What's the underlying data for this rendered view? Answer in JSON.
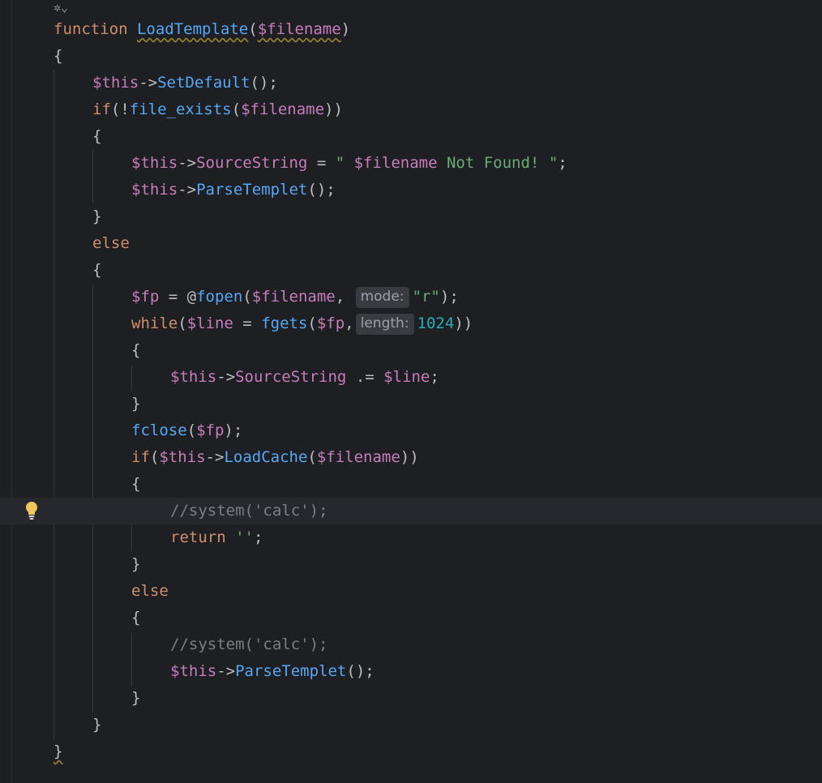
{
  "editor": {
    "top_icon": "✲⌄",
    "lines": [
      {
        "id": "l1",
        "tokens": [
          [
            "kw",
            "function"
          ],
          [
            "punc",
            " "
          ],
          [
            "fn-decl",
            "LoadTemplate"
          ],
          [
            "punc",
            "("
          ],
          [
            "param",
            "$filename"
          ],
          [
            "punc",
            ")"
          ]
        ]
      },
      {
        "id": "l2",
        "tokens": [
          [
            "punc",
            "{"
          ]
        ]
      },
      {
        "id": "l3",
        "tokens": [
          [
            "var",
            "$this"
          ],
          [
            "punc",
            "->"
          ],
          [
            "call",
            "SetDefault"
          ],
          [
            "punc",
            "();"
          ]
        ]
      },
      {
        "id": "l4",
        "tokens": [
          [
            "kw",
            "if"
          ],
          [
            "punc",
            "(!"
          ],
          [
            "call",
            "file_exists"
          ],
          [
            "punc",
            "("
          ],
          [
            "var",
            "$filename"
          ],
          [
            "punc",
            "))"
          ]
        ]
      },
      {
        "id": "l5",
        "tokens": [
          [
            "punc",
            "{"
          ]
        ]
      },
      {
        "id": "l6",
        "tokens": [
          [
            "var",
            "$this"
          ],
          [
            "punc",
            "->"
          ],
          [
            "prop",
            "SourceString"
          ],
          [
            "punc",
            " = "
          ],
          [
            "strq",
            "\" "
          ],
          [
            "var",
            "$filename"
          ],
          [
            "str",
            " Not Found! "
          ],
          [
            "strq",
            "\""
          ],
          [
            "punc",
            ";"
          ]
        ]
      },
      {
        "id": "l7",
        "tokens": [
          [
            "var",
            "$this"
          ],
          [
            "punc",
            "->"
          ],
          [
            "call",
            "ParseTemplet"
          ],
          [
            "punc",
            "();"
          ]
        ]
      },
      {
        "id": "l8",
        "tokens": [
          [
            "punc",
            "}"
          ]
        ]
      },
      {
        "id": "l9",
        "tokens": [
          [
            "kw",
            "else"
          ]
        ]
      },
      {
        "id": "l10",
        "tokens": [
          [
            "punc",
            "{"
          ]
        ]
      },
      {
        "id": "l11",
        "tokens": [
          [
            "var",
            "$fp"
          ],
          [
            "punc",
            " = @"
          ],
          [
            "call",
            "fopen"
          ],
          [
            "punc",
            "("
          ],
          [
            "var",
            "$filename"
          ],
          [
            "punc",
            ", "
          ],
          [
            "hint",
            "mode:"
          ],
          [
            "str",
            "\"r\""
          ],
          [
            "punc",
            ");"
          ]
        ]
      },
      {
        "id": "l12",
        "tokens": [
          [
            "kw",
            "while"
          ],
          [
            "punc",
            "("
          ],
          [
            "var",
            "$line"
          ],
          [
            "punc",
            " = "
          ],
          [
            "call",
            "fgets"
          ],
          [
            "punc",
            "("
          ],
          [
            "var",
            "$fp"
          ],
          [
            "punc",
            ","
          ],
          [
            "hint",
            "length:"
          ],
          [
            "num",
            "1024"
          ],
          [
            "punc",
            "))"
          ]
        ]
      },
      {
        "id": "l13",
        "tokens": [
          [
            "punc",
            "{"
          ]
        ]
      },
      {
        "id": "l14",
        "tokens": [
          [
            "var",
            "$this"
          ],
          [
            "punc",
            "->"
          ],
          [
            "prop",
            "SourceString"
          ],
          [
            "punc",
            " .= "
          ],
          [
            "var",
            "$line"
          ],
          [
            "punc",
            ";"
          ]
        ]
      },
      {
        "id": "l15",
        "tokens": [
          [
            "punc",
            "}"
          ]
        ]
      },
      {
        "id": "l16",
        "tokens": [
          [
            "call",
            "fclose"
          ],
          [
            "punc",
            "("
          ],
          [
            "var",
            "$fp"
          ],
          [
            "punc",
            ");"
          ]
        ]
      },
      {
        "id": "l17",
        "tokens": [
          [
            "kw",
            "if"
          ],
          [
            "punc",
            "("
          ],
          [
            "var",
            "$this"
          ],
          [
            "punc",
            "->"
          ],
          [
            "call",
            "LoadCache"
          ],
          [
            "punc",
            "("
          ],
          [
            "var",
            "$filename"
          ],
          [
            "punc",
            "))"
          ]
        ]
      },
      {
        "id": "l18",
        "tokens": [
          [
            "punc",
            "{"
          ]
        ]
      },
      {
        "id": "l19",
        "tokens": [
          [
            "cmt",
            "//system('calc');"
          ]
        ]
      },
      {
        "id": "l20",
        "tokens": [
          [
            "kw",
            "return"
          ],
          [
            "punc",
            " "
          ],
          [
            "str",
            "''"
          ],
          [
            "punc",
            ";"
          ]
        ]
      },
      {
        "id": "l21",
        "tokens": [
          [
            "punc",
            "}"
          ]
        ]
      },
      {
        "id": "l22",
        "tokens": [
          [
            "kw",
            "else"
          ]
        ]
      },
      {
        "id": "l23",
        "tokens": [
          [
            "punc",
            "{"
          ]
        ]
      },
      {
        "id": "l24",
        "tokens": [
          [
            "cmt",
            "//system('calc');"
          ]
        ]
      },
      {
        "id": "l25",
        "tokens": [
          [
            "var",
            "$this"
          ],
          [
            "punc",
            "->"
          ],
          [
            "call",
            "ParseTemplet"
          ],
          [
            "punc",
            "();"
          ]
        ]
      },
      {
        "id": "l26",
        "tokens": [
          [
            "punc",
            "}"
          ]
        ]
      },
      {
        "id": "l27",
        "tokens": [
          [
            "punc",
            "}"
          ]
        ]
      },
      {
        "id": "l28",
        "tokens": [
          [
            "punc",
            "}"
          ]
        ]
      }
    ]
  }
}
